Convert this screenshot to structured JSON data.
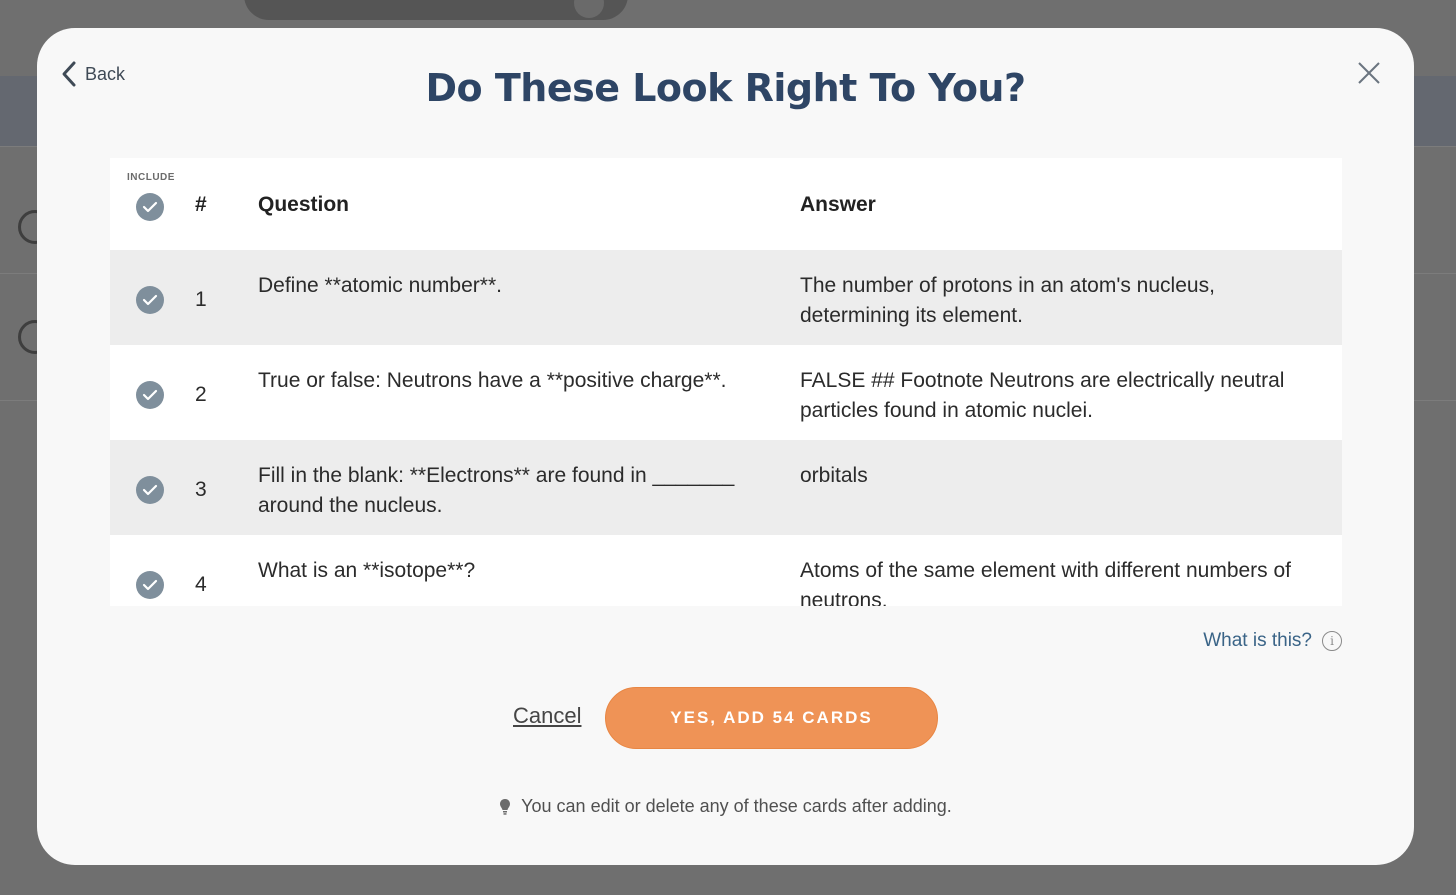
{
  "modal": {
    "back_label": "Back",
    "title": "Do These Look Right To You?"
  },
  "table": {
    "include_label": "INCLUDE",
    "headers": {
      "num": "#",
      "question": "Question",
      "answer": "Answer"
    },
    "rows": [
      {
        "num": "1",
        "question": "Define **atomic number**.",
        "answer": "The number of protons in an atom's nucleus, determining its element.",
        "included": true
      },
      {
        "num": "2",
        "question": "True or false: Neutrons have a **positive charge**.",
        "answer": "FALSE ## Footnote Neutrons are electrically neutral particles found in atomic nuclei.",
        "included": true
      },
      {
        "num": "3",
        "question": "Fill in the blank: **Electrons** are found in _______ around the nucleus.",
        "answer": "orbitals",
        "included": true
      },
      {
        "num": "4",
        "question": "What is an **isotope**?",
        "answer": "Atoms of the same element with different numbers of neutrons.",
        "included": true
      }
    ]
  },
  "help_link": "What is this?",
  "actions": {
    "cancel_label": "Cancel",
    "confirm_label": "YES, ADD 54 CARDS"
  },
  "tip": "You can edit or delete any of these cards after adding.",
  "colors": {
    "title": "#2e4565",
    "accent_button": "#ef9356",
    "check": "#7f8f9c",
    "link": "#3a6487"
  }
}
